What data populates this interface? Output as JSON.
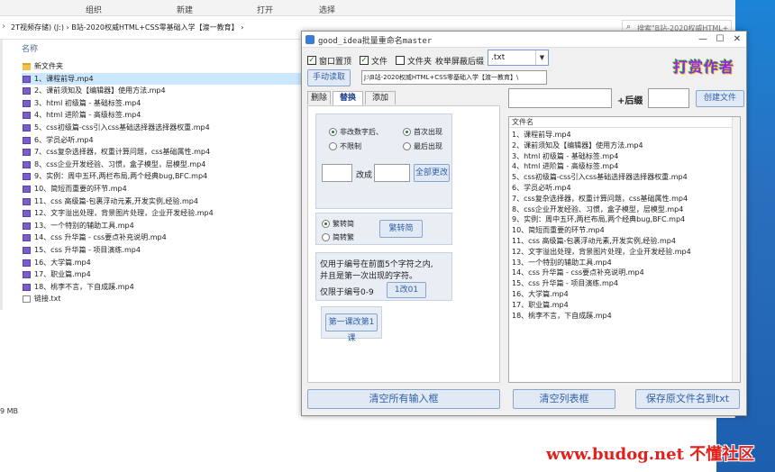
{
  "explorer": {
    "ribbon": [
      "组织",
      "新建",
      "打开",
      "选择"
    ],
    "address": "2T视频存储) (J:)  ›  B站-2020权威HTML+CSS零基础入学【渡一教育】  ›",
    "search_placeholder": "搜索\"B站-2020权威HTML+...",
    "column_name": "名称",
    "files": [
      {
        "name": "新文件夹",
        "type": "folder"
      },
      {
        "name": "1、课程前导.mp4",
        "type": "video"
      },
      {
        "name": "2、课前须知及【编辑器】使用方法.mp4",
        "type": "video"
      },
      {
        "name": "3、html 初级篇 - 基础标签.mp4",
        "type": "video"
      },
      {
        "name": "4、html 进阶篇 - 高级标签.mp4",
        "type": "video"
      },
      {
        "name": "5、css初级篇-css引入css基础选择器选择器权重.mp4",
        "type": "video"
      },
      {
        "name": "6、学员必听.mp4",
        "type": "video"
      },
      {
        "name": "7、css复杂选择器，权重计算问题，css基础属性.mp4",
        "type": "video"
      },
      {
        "name": "8、css企业开发经验、习惯，盒子模型，层模型.mp4",
        "type": "video"
      },
      {
        "name": "9、实例：周中五环,两栏布局,两个经典bug,BFC.mp4",
        "type": "video"
      },
      {
        "name": "10、简短而重要的环节.mp4",
        "type": "video"
      },
      {
        "name": "11、css 高级篇-包裹浮动元素,开发实例,经验.mp4",
        "type": "video"
      },
      {
        "name": "12、文字溢出处理，背景图片处理，企业开发经验.mp4",
        "type": "video"
      },
      {
        "name": "13、一个特别的辅助工具.mp4",
        "type": "video"
      },
      {
        "name": "14、css 升华篇 - css要点补充说明.mp4",
        "type": "video"
      },
      {
        "name": "15、css 升华篇 - 项目演练.mp4",
        "type": "video"
      },
      {
        "name": "16、大学篇.mp4",
        "type": "video"
      },
      {
        "name": "17、职业篇.mp4",
        "type": "video"
      },
      {
        "name": "18、桃李不言，下自成蹊.mp4",
        "type": "video"
      },
      {
        "name": "链接.txt",
        "type": "txt"
      }
    ],
    "status_size": "9 MB"
  },
  "app": {
    "title": "good_idea批量重命名master",
    "window_buttons": {
      "minimize": "—",
      "maximize": "☐",
      "close": "✕"
    },
    "options": {
      "window_topmost": {
        "label": "窗口置顶",
        "checked": true
      },
      "file": {
        "label": "文件",
        "checked": true
      },
      "folder": {
        "label": "文件夹",
        "checked": false
      },
      "ext_label": "枚举屏蔽后缀",
      "ext_value": ".txt"
    },
    "manual_read": "手动读取",
    "path": "J:\\B站-2020权威HTML+CSS零基础入学【渡一教育】\\",
    "logo_text": "打赏作者",
    "tabs": [
      "删除",
      "替换",
      "添加"
    ],
    "replace": {
      "mode_options": [
        {
          "label": "非改数字后、",
          "selected": true
        },
        {
          "label": "不限制",
          "selected": false
        }
      ],
      "position_options": [
        {
          "label": "首次出现",
          "selected": true
        },
        {
          "label": "最后出现",
          "selected": false
        }
      ],
      "change_label": "改成",
      "replace_all": "全部更改",
      "convert_options": [
        {
          "label": "繁转简",
          "selected": true
        },
        {
          "label": "简转繁",
          "selected": false
        }
      ],
      "convert_button": "繁转简",
      "note_line1": "仅用于编号在前面5个字符之内,",
      "note_line2": "并且是第一次出现的字符。",
      "digits_label": "仅限于编号0-9",
      "digits_button": "1改01",
      "chapter_button": "第一课改第1课"
    },
    "suffix_label": "+后缀",
    "create_file": "创建文件",
    "list_header": "文件名",
    "list_files": [
      "1、课程前导.mp4",
      "2、课前须知及【编辑器】使用方法.mp4",
      "3、html 初级篇 - 基础标签.mp4",
      "4、html 进阶篇 - 高级标签.mp4",
      "5、css初级篇-css引入css基础选择器选择器权重.mp4",
      "6、学员必听.mp4",
      "7、css复杂选择器，权重计算问题，css基础属性.mp4",
      "8、css企业开发经验、习惯，盒子模型，层模型.mp4",
      "9、实例：周中五环,两栏布局,两个经典bug,BFC.mp4",
      "10、简短而重要的环节.mp4",
      "11、css 高级篇-包裹浮动元素,开发实例,经验.mp4",
      "12、文字溢出处理，背景图片处理，企业开发经验.mp4",
      "13、一个特别的辅助工具.mp4",
      "14、css 升华篇 - css要点补充说明.mp4",
      "15、css 升华篇 - 项目演练.mp4",
      "16、大学篇.mp4",
      "17、职业篇.mp4",
      "18、桃李不言，下自成蹊.mp4"
    ],
    "clear_inputs": "清空所有输入框",
    "clear_list": "清空列表框",
    "save_names": "保存原文件名到txt"
  },
  "watermark": "www.budog.net 不懂社区",
  "colors": {
    "accent": "#2e5fa8",
    "selection": "#cce8ff",
    "watermark": "#e2211c",
    "desktop": "#1d5fae"
  }
}
